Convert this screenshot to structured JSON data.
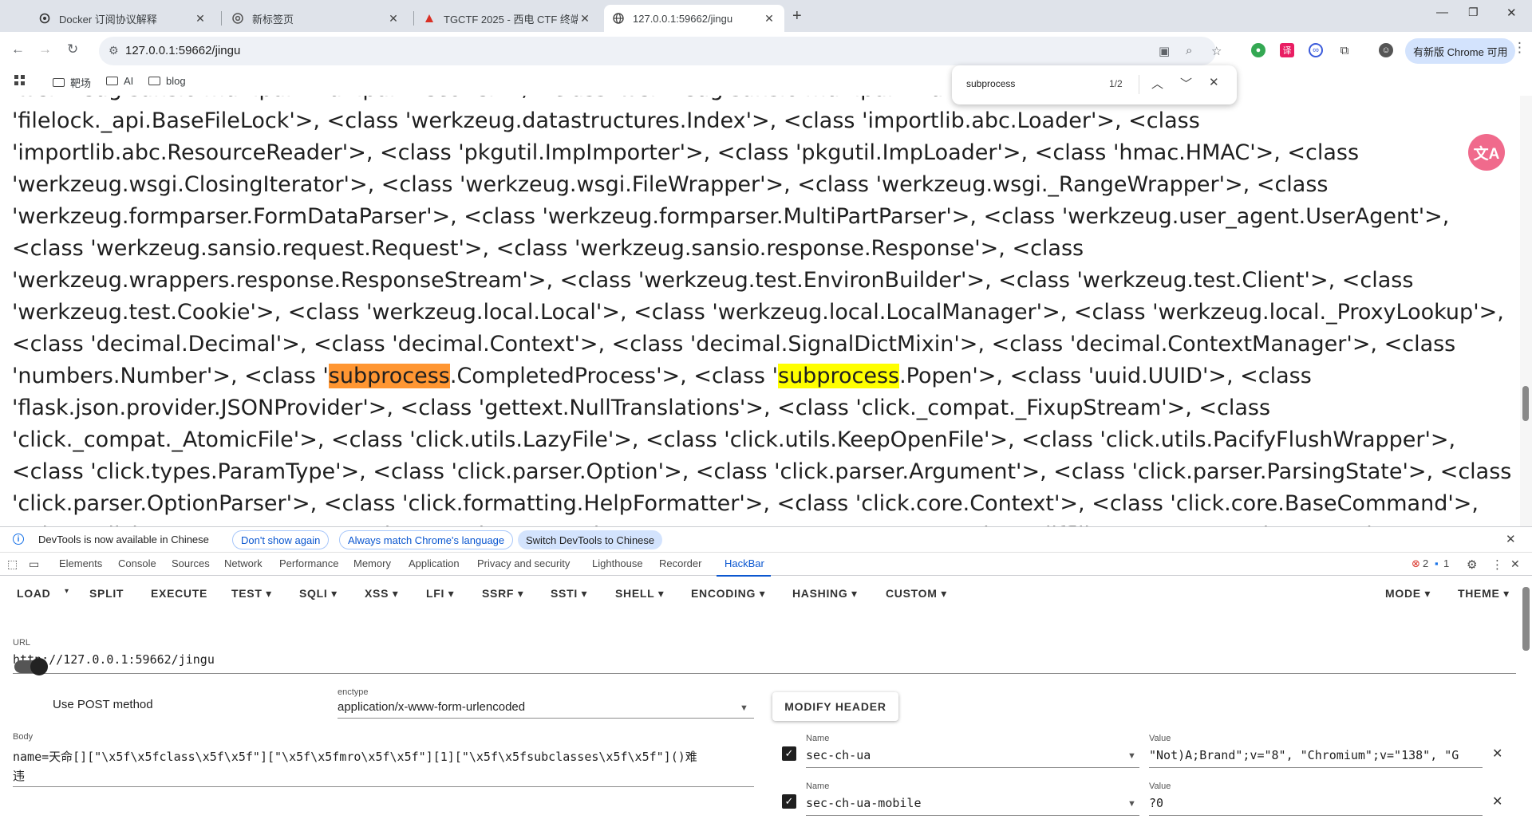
{
  "tabs": [
    {
      "label": "Docker 订阅协议解释",
      "icon": "gpt-icon"
    },
    {
      "label": "新标签页",
      "icon": "chrome-icon"
    },
    {
      "label": "TGCTF 2025 - 西电 CTF 终端",
      "icon": "ctf-icon"
    },
    {
      "label": "127.0.0.1:59662/jingu",
      "icon": "globe-icon"
    }
  ],
  "address": {
    "url": "127.0.0.1:59662/jingu"
  },
  "update_button": "有新版 Chrome 可用",
  "bookmarks": [
    {
      "label": "靶场"
    },
    {
      "label": "AI"
    },
    {
      "label": "blog"
    }
  ],
  "find": {
    "query": "subprocess",
    "count": "1/2"
  },
  "page": {
    "before": "'werkzeug.sansio.multipart.MultipartDecoder'>, <class 'werkzeug.sansio.multipart.MultipartEncoder'>, <class 'filelock._api.BaseFileLock'>, <class 'werkzeug.datastructures.Index'>, <class 'importlib.abc.Loader'>, <class 'importlib.abc.ResourceReader'>, <class 'pkgutil.ImpImporter'>, <class 'pkgutil.ImpLoader'>, <class 'hmac.HMAC'>, <class 'werkzeug.wsgi.ClosingIterator'>, <class 'werkzeug.wsgi.FileWrapper'>, <class 'werkzeug.wsgi._RangeWrapper'>, <class 'werkzeug.formparser.FormDataParser'>, <class 'werkzeug.formparser.MultiPartParser'>, <class 'werkzeug.user_agent.UserAgent'>, <class 'werkzeug.sansio.request.Request'>, <class 'werkzeug.sansio.response.Response'>, <class 'werkzeug.wrappers.response.ResponseStream'>, <class 'werkzeug.test.EnvironBuilder'>, <class 'werkzeug.test.Client'>, <class 'werkzeug.test.Cookie'>, <class 'werkzeug.local.Local'>, <class 'werkzeug.local.LocalManager'>, <class 'werkzeug.local._ProxyLookup'>, <class 'decimal.Decimal'>, <class 'decimal.Context'>, <class 'decimal.SignalDictMixin'>, <class 'decimal.ContextManager'>, <class 'numbers.Number'>, <class '",
    "match1": "subprocess",
    "middle": ".CompletedProcess'>, <class '",
    "match2": "subprocess",
    "after": ".Popen'>, <class 'uuid.UUID'>, <class 'flask.json.provider.JSONProvider'>, <class 'gettext.NullTranslations'>, <class 'click._compat._FixupStream'>, <class 'click._compat._AtomicFile'>, <class 'click.utils.LazyFile'>, <class 'click.utils.KeepOpenFile'>, <class 'click.utils.PacifyFlushWrapper'>, <class 'click.types.ParamType'>, <class 'click.parser.Option'>, <class 'click.parser.Argument'>, <class 'click.parser.ParsingState'>, <class 'click.parser.OptionParser'>, <class 'click.formatting.HelpFormatter'>, <class 'click.core.Context'>, <class 'click.core.BaseCommand'>, <class 'click.core.Parameter'>, <class 'werkzeug.routing.converters.BaseConverter'>, <class 'difflib.SequenceMatcher'>, <class 'difflib.Differ'>, <class 'difflib.HtmlDiff'>, <class 'pprint._safe_key'>, <class 'pprint.PrettyPrinter'>, <class 'werkzeug.routing.rules.RulePart'>, <class 'werkzeug.routing.rules.RuleFactory'>, <class"
  },
  "devtools": {
    "notice": "DevTools is now available in Chinese",
    "dont_show": "Don't show again",
    "always_match": "Always match Chrome's language",
    "switch": "Switch DevTools to Chinese",
    "tabs": [
      "Elements",
      "Console",
      "Sources",
      "Network",
      "Performance",
      "Memory",
      "Application",
      "Privacy and security",
      "Lighthouse",
      "Recorder",
      "HackBar"
    ],
    "errors": "2",
    "messages": "1"
  },
  "hackbar": {
    "menu": [
      "LOAD",
      "SPLIT",
      "EXECUTE",
      "TEST",
      "SQLI",
      "XSS",
      "LFI",
      "SSRF",
      "SSTI",
      "SHELL",
      "ENCODING",
      "HASHING",
      "CUSTOM",
      "MODE",
      "THEME"
    ],
    "url_label": "URL",
    "url_value": "http://127.0.0.1:59662/jingu",
    "post_label": "Use POST method",
    "enctype_label": "enctype",
    "enctype_value": "application/x-www-form-urlencoded",
    "body_label": "Body",
    "body_line1": "name=天命[][\"\\x5f\\x5fclass\\x5f\\x5f\"][\"\\x5f\\x5fmro\\x5f\\x5f\"][1][\"\\x5f\\x5fsubclasses\\x5f\\x5f\"]()难",
    "body_line2": "违",
    "modify_header": "MODIFY HEADER",
    "name_label": "Name",
    "value_label": "Value",
    "headers": [
      {
        "name": "sec-ch-ua",
        "value": "\"Not)A;Brand\";v=\"8\", \"Chromium\";v=\"138\", \"G"
      },
      {
        "name": "sec-ch-ua-mobile",
        "value": "?0"
      }
    ]
  }
}
